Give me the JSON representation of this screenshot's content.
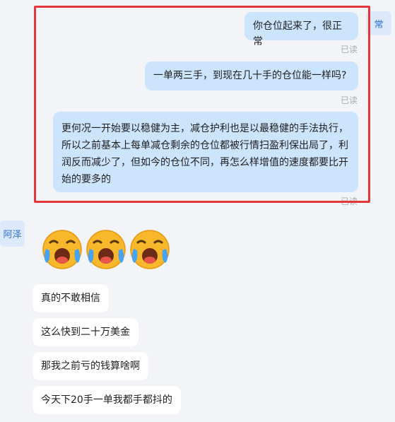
{
  "self_avatar": {
    "label": "常"
  },
  "other_avatar": {
    "label": "阿泽"
  },
  "outgoing": [
    {
      "text": "你仓位起来了，很正常",
      "status": "已读"
    },
    {
      "text": "一单两三手，到现在几十手的仓位能一样吗?",
      "status": "已读"
    },
    {
      "text": "更何况一开始要以稳健为主，减仓护利也是以最稳健的手法执行，所以之前基本上每单减仓剩余的仓位都被行情扫盈利保出局了，利润反而减少了，但如今的仓位不同，再怎么样增值的速度都要比开始的要多的",
      "status": "已读"
    }
  ],
  "incoming": [
    {
      "emoji": [
        "crying-face-icon",
        "crying-face-icon",
        "crying-face-icon"
      ]
    },
    {
      "text": "真的不敢相信"
    },
    {
      "text": "这么快到二十万美金"
    },
    {
      "text": "那我之前亏的钱算啥啊"
    },
    {
      "text": "今天下20手一单我都手都抖的"
    }
  ],
  "colors": {
    "highlight_border": "#e5363b",
    "outgoing_bubble": "#cde4fd",
    "incoming_bubble": "#ffffff",
    "avatar_text": "#2f6fd6",
    "background": "#f3f4f7"
  }
}
